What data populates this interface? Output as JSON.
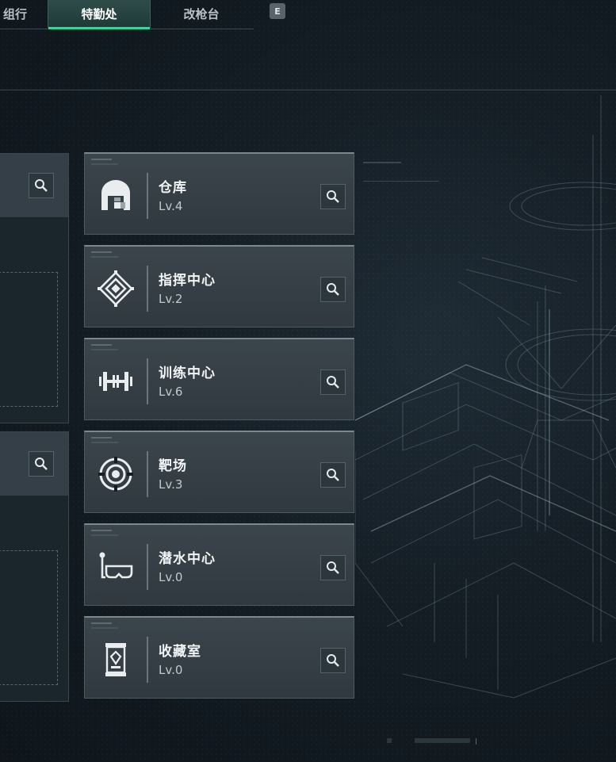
{
  "tabs": [
    {
      "label": "组行",
      "active": false
    },
    {
      "label": "特勤处",
      "active": true
    },
    {
      "label": "改枪台",
      "active": false
    }
  ],
  "key_hint": "E",
  "facilities": [
    {
      "name": "仓库",
      "level": "Lv.4",
      "icon": "warehouse-icon"
    },
    {
      "name": "指挥中心",
      "level": "Lv.2",
      "icon": "command-center-icon"
    },
    {
      "name": "训练中心",
      "level": "Lv.6",
      "icon": "dumbbell-icon"
    },
    {
      "name": "靶场",
      "level": "Lv.3",
      "icon": "target-icon"
    },
    {
      "name": "潜水中心",
      "level": "Lv.0",
      "icon": "diving-mask-icon"
    },
    {
      "name": "收藏室",
      "level": "Lv.0",
      "icon": "collection-case-icon"
    }
  ],
  "colors": {
    "accent": "#3ed29a",
    "card": "#343e45",
    "background": "#141d24"
  }
}
